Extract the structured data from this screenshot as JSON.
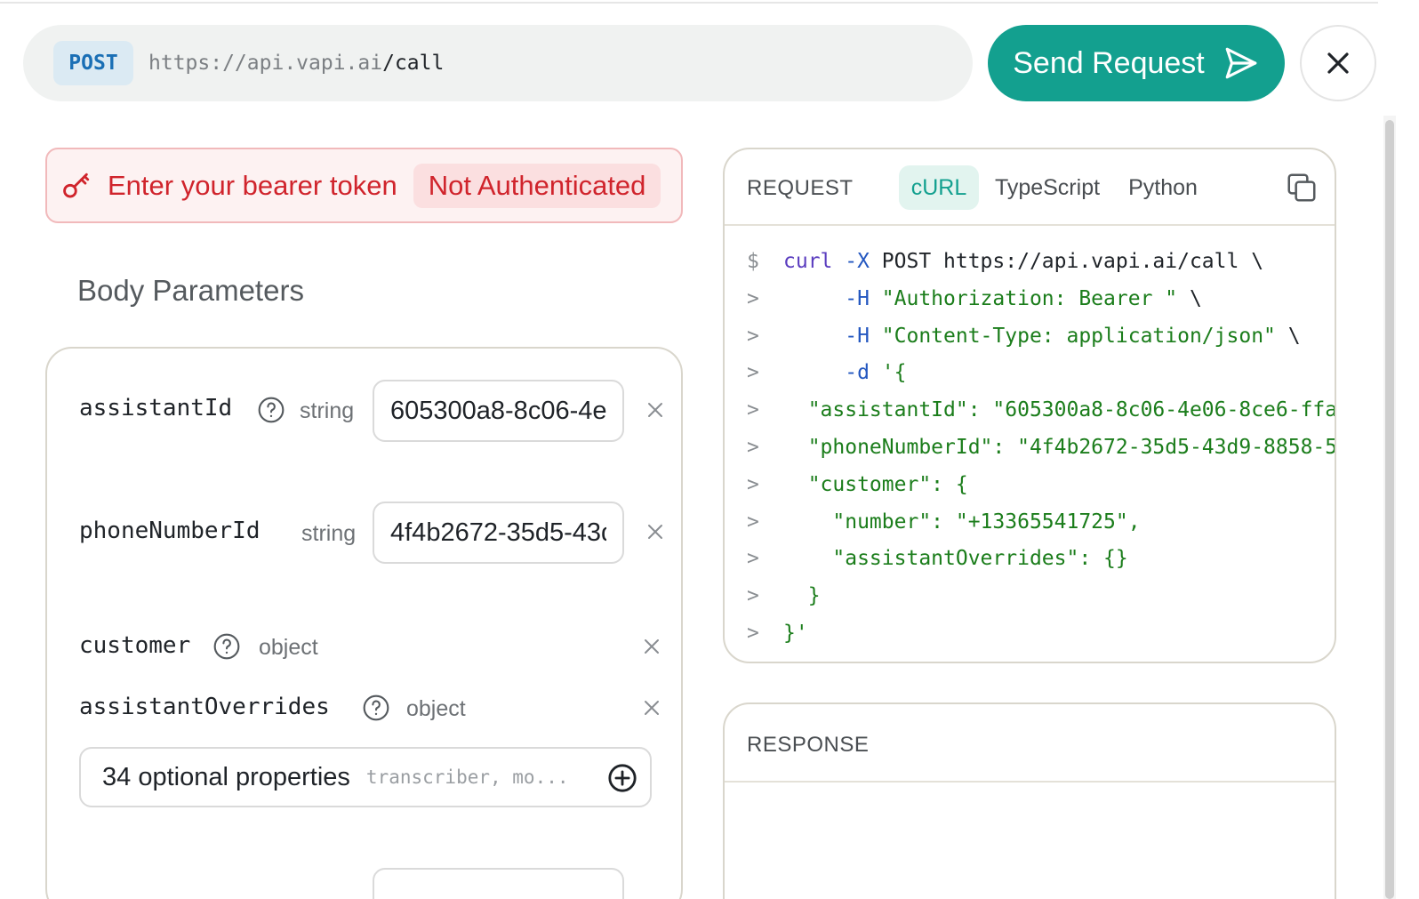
{
  "request_bar": {
    "method": "POST",
    "url_base": "https://api.vapi.ai",
    "url_path": "/call",
    "send_label": "Send Request"
  },
  "auth": {
    "prompt": "Enter your bearer token",
    "status": "Not Authenticated"
  },
  "body": {
    "title": "Body Parameters",
    "params": [
      {
        "name": "assistantId",
        "type": "string",
        "value": "605300a8-8c06-4e06-8ce6-ffa"
      },
      {
        "name": "phoneNumberId",
        "type": "string",
        "value": "4f4b2672-35d5-43d9-8858-5"
      },
      {
        "name": "customer",
        "type": "object"
      },
      {
        "name": "assistantOverrides",
        "type": "object"
      }
    ],
    "optional": {
      "label": "34 optional properties",
      "hint": "transcriber, mo..."
    }
  },
  "request_panel": {
    "label": "REQUEST",
    "tabs": [
      "cURL",
      "TypeScript",
      "Python"
    ],
    "active_tab": "cURL",
    "code_lines": [
      {
        "prompt": "$",
        "tokens": [
          {
            "t": "curl",
            "c": "kw"
          },
          {
            "t": " -X",
            "c": "fl"
          },
          {
            "t": " POST https://api.vapi.ai/call \\",
            "c": "pl"
          }
        ]
      },
      {
        "prompt": ">",
        "tokens": [
          {
            "t": "     -H",
            "c": "fl"
          },
          {
            "t": " \"Authorization: Bearer \"",
            "c": "str"
          },
          {
            "t": " \\",
            "c": "pl"
          }
        ]
      },
      {
        "prompt": ">",
        "tokens": [
          {
            "t": "     -H",
            "c": "fl"
          },
          {
            "t": " \"Content-Type: application/json\"",
            "c": "str"
          },
          {
            "t": " \\",
            "c": "pl"
          }
        ]
      },
      {
        "prompt": ">",
        "tokens": [
          {
            "t": "     -d",
            "c": "fl"
          },
          {
            "t": " '{",
            "c": "str"
          }
        ]
      },
      {
        "prompt": ">",
        "tokens": [
          {
            "t": "  \"assistantId\": \"605300a8-8c06-4e06-8ce6-ffa",
            "c": "str"
          }
        ]
      },
      {
        "prompt": ">",
        "tokens": [
          {
            "t": "  \"phoneNumberId\": \"4f4b2672-35d5-43d9-8858-5",
            "c": "str"
          }
        ]
      },
      {
        "prompt": ">",
        "tokens": [
          {
            "t": "  \"customer\": {",
            "c": "str"
          }
        ]
      },
      {
        "prompt": ">",
        "tokens": [
          {
            "t": "    \"number\": \"+13365541725\",",
            "c": "str"
          }
        ]
      },
      {
        "prompt": ">",
        "tokens": [
          {
            "t": "    \"assistantOverrides\": {}",
            "c": "str"
          }
        ]
      },
      {
        "prompt": ">",
        "tokens": [
          {
            "t": "  }",
            "c": "str"
          }
        ]
      },
      {
        "prompt": ">",
        "tokens": [
          {
            "t": "}'",
            "c": "str"
          }
        ]
      }
    ]
  },
  "response_panel": {
    "label": "RESPONSE"
  },
  "colors": {
    "accent": "#13a08f",
    "error": "#d0242c",
    "method_badge": "#1a6fb5"
  }
}
